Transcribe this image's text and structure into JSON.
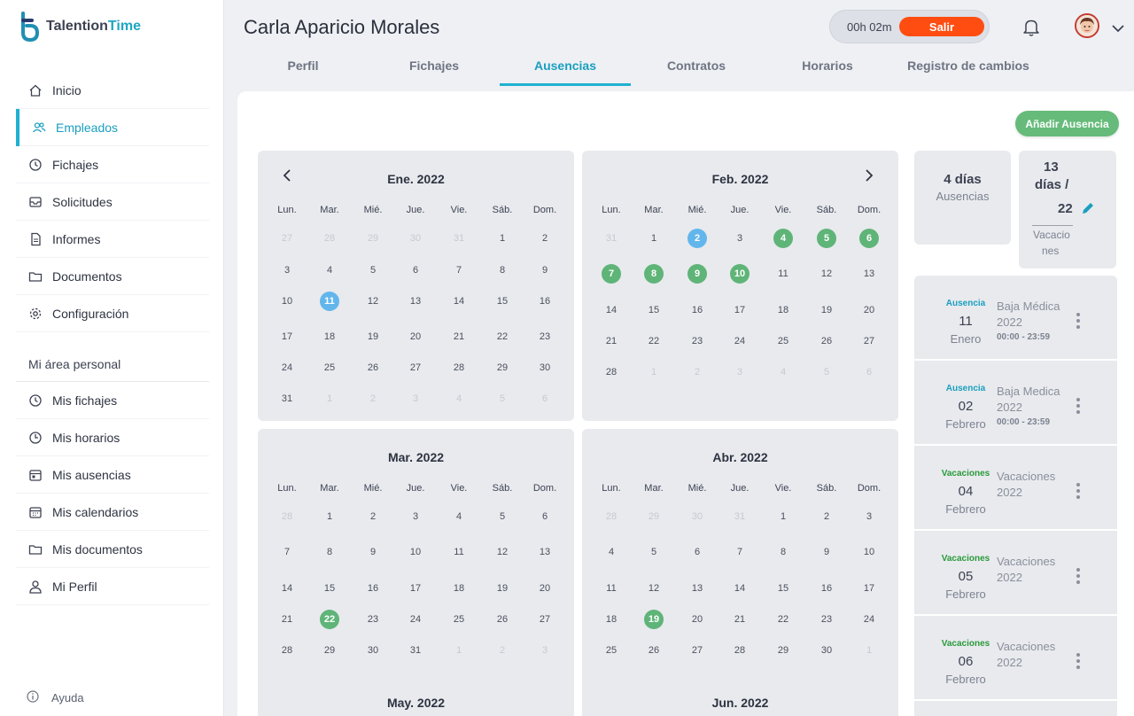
{
  "app": {
    "brand_a": "Talention",
    "brand_b": "Time"
  },
  "sidebar": {
    "items": [
      {
        "label": "Inicio",
        "icon": "home-icon",
        "active": false
      },
      {
        "label": "Empleados",
        "icon": "users-icon",
        "active": true
      },
      {
        "label": "Fichajes",
        "icon": "clock-icon",
        "active": false
      },
      {
        "label": "Solicitudes",
        "icon": "inbox-icon",
        "active": false
      },
      {
        "label": "Informes",
        "icon": "document-icon",
        "active": false
      },
      {
        "label": "Documentos",
        "icon": "folder-icon",
        "active": false
      },
      {
        "label": "Configuración",
        "icon": "gear-icon",
        "active": false
      }
    ],
    "personal_title": "Mi área personal",
    "personal_items": [
      {
        "label": "Mis fichajes",
        "icon": "clock-icon"
      },
      {
        "label": "Mis horarios",
        "icon": "time-icon"
      },
      {
        "label": "Mis ausencias",
        "icon": "calendar-icon"
      },
      {
        "label": "Mis calendarios",
        "icon": "calendar-grid-icon"
      },
      {
        "label": "Mis documentos",
        "icon": "folder-icon"
      },
      {
        "label": "Mi Perfil",
        "icon": "user-icon"
      }
    ],
    "help": "Ayuda"
  },
  "header": {
    "employee_name": "Carla Aparicio Morales",
    "timer": "00h 02m",
    "exit_label": "Salir"
  },
  "tabs": [
    {
      "label": "Perfil",
      "active": false
    },
    {
      "label": "Fichajes",
      "active": false
    },
    {
      "label": "Ausencias",
      "active": true
    },
    {
      "label": "Contratos",
      "active": false
    },
    {
      "label": "Horarios",
      "active": false
    },
    {
      "label": "Registro de cambios",
      "active": false
    }
  ],
  "add_button": "Añadir Ausencia",
  "weekdays": [
    "Lun.",
    "Mar.",
    "Mié.",
    "Jue.",
    "Vie.",
    "Sáb.",
    "Dom."
  ],
  "months": [
    {
      "title": "Ene. 2022",
      "nav": "prev",
      "weeks": [
        [
          [
            "27",
            "o"
          ],
          [
            "28",
            "o"
          ],
          [
            "29",
            "o"
          ],
          [
            "30",
            "o"
          ],
          [
            "31",
            "o"
          ],
          [
            "1",
            ""
          ],
          [
            "2",
            ""
          ]
        ],
        [
          [
            "3",
            ""
          ],
          [
            "4",
            ""
          ],
          [
            "5",
            ""
          ],
          [
            "6",
            ""
          ],
          [
            "7",
            ""
          ],
          [
            "8",
            ""
          ],
          [
            "9",
            ""
          ]
        ],
        [
          [
            "10",
            ""
          ],
          [
            "11",
            "a"
          ],
          [
            "12",
            ""
          ],
          [
            "13",
            ""
          ],
          [
            "14",
            ""
          ],
          [
            "15",
            ""
          ],
          [
            "16",
            ""
          ]
        ],
        [
          [
            "17",
            ""
          ],
          [
            "18",
            ""
          ],
          [
            "19",
            ""
          ],
          [
            "20",
            ""
          ],
          [
            "21",
            ""
          ],
          [
            "22",
            ""
          ],
          [
            "23",
            ""
          ]
        ],
        [
          [
            "24",
            ""
          ],
          [
            "25",
            ""
          ],
          [
            "26",
            ""
          ],
          [
            "27",
            ""
          ],
          [
            "28",
            ""
          ],
          [
            "29",
            ""
          ],
          [
            "30",
            ""
          ]
        ],
        [
          [
            "31",
            ""
          ],
          [
            "1",
            "o"
          ],
          [
            "2",
            "o"
          ],
          [
            "3",
            "o"
          ],
          [
            "4",
            "o"
          ],
          [
            "5",
            "o"
          ],
          [
            "6",
            "o"
          ]
        ]
      ]
    },
    {
      "title": "Feb. 2022",
      "nav": "next",
      "weeks": [
        [
          [
            "31",
            "o"
          ],
          [
            "1",
            ""
          ],
          [
            "2",
            "a"
          ],
          [
            "3",
            ""
          ],
          [
            "4",
            "v"
          ],
          [
            "5",
            "v"
          ],
          [
            "6",
            "v"
          ]
        ],
        [
          [
            "7",
            "v"
          ],
          [
            "8",
            "v"
          ],
          [
            "9",
            "v"
          ],
          [
            "10",
            "v"
          ],
          [
            "11",
            ""
          ],
          [
            "12",
            ""
          ],
          [
            "13",
            ""
          ]
        ],
        [
          [
            "14",
            ""
          ],
          [
            "15",
            ""
          ],
          [
            "16",
            ""
          ],
          [
            "17",
            ""
          ],
          [
            "18",
            ""
          ],
          [
            "19",
            ""
          ],
          [
            "20",
            ""
          ]
        ],
        [
          [
            "21",
            ""
          ],
          [
            "22",
            ""
          ],
          [
            "23",
            ""
          ],
          [
            "24",
            ""
          ],
          [
            "25",
            ""
          ],
          [
            "26",
            ""
          ],
          [
            "27",
            ""
          ]
        ],
        [
          [
            "28",
            ""
          ],
          [
            "1",
            "o"
          ],
          [
            "2",
            "o"
          ],
          [
            "3",
            "o"
          ],
          [
            "4",
            "o"
          ],
          [
            "5",
            "o"
          ],
          [
            "6",
            "o"
          ]
        ]
      ]
    },
    {
      "title": "Mar. 2022",
      "nav": "",
      "weeks": [
        [
          [
            "28",
            "o"
          ],
          [
            "1",
            ""
          ],
          [
            "2",
            ""
          ],
          [
            "3",
            ""
          ],
          [
            "4",
            ""
          ],
          [
            "5",
            ""
          ],
          [
            "6",
            ""
          ]
        ],
        [
          [
            "7",
            ""
          ],
          [
            "8",
            ""
          ],
          [
            "9",
            ""
          ],
          [
            "10",
            ""
          ],
          [
            "11",
            ""
          ],
          [
            "12",
            ""
          ],
          [
            "13",
            ""
          ]
        ],
        [
          [
            "14",
            ""
          ],
          [
            "15",
            ""
          ],
          [
            "16",
            ""
          ],
          [
            "17",
            ""
          ],
          [
            "18",
            ""
          ],
          [
            "19",
            ""
          ],
          [
            "20",
            ""
          ]
        ],
        [
          [
            "21",
            ""
          ],
          [
            "22",
            "v"
          ],
          [
            "23",
            ""
          ],
          [
            "24",
            ""
          ],
          [
            "25",
            ""
          ],
          [
            "26",
            ""
          ],
          [
            "27",
            ""
          ]
        ],
        [
          [
            "28",
            ""
          ],
          [
            "29",
            ""
          ],
          [
            "30",
            ""
          ],
          [
            "31",
            ""
          ],
          [
            "1",
            "o"
          ],
          [
            "2",
            "o"
          ],
          [
            "3",
            "o"
          ]
        ]
      ]
    },
    {
      "title": "Abr. 2022",
      "nav": "",
      "weeks": [
        [
          [
            "28",
            "o"
          ],
          [
            "29",
            "o"
          ],
          [
            "30",
            "o"
          ],
          [
            "31",
            "o"
          ],
          [
            "1",
            ""
          ],
          [
            "2",
            ""
          ],
          [
            "3",
            ""
          ]
        ],
        [
          [
            "4",
            ""
          ],
          [
            "5",
            ""
          ],
          [
            "6",
            ""
          ],
          [
            "7",
            ""
          ],
          [
            "8",
            ""
          ],
          [
            "9",
            ""
          ],
          [
            "10",
            ""
          ]
        ],
        [
          [
            "11",
            ""
          ],
          [
            "12",
            ""
          ],
          [
            "13",
            ""
          ],
          [
            "14",
            ""
          ],
          [
            "15",
            ""
          ],
          [
            "16",
            ""
          ],
          [
            "17",
            ""
          ]
        ],
        [
          [
            "18",
            ""
          ],
          [
            "19",
            "v"
          ],
          [
            "20",
            ""
          ],
          [
            "21",
            ""
          ],
          [
            "22",
            ""
          ],
          [
            "23",
            ""
          ],
          [
            "24",
            ""
          ]
        ],
        [
          [
            "25",
            ""
          ],
          [
            "26",
            ""
          ],
          [
            "27",
            ""
          ],
          [
            "28",
            ""
          ],
          [
            "29",
            ""
          ],
          [
            "30",
            ""
          ],
          [
            "1",
            "o"
          ]
        ]
      ]
    },
    {
      "title": "May. 2022",
      "nav": "",
      "weeks": []
    },
    {
      "title": "Jun. 2022",
      "nav": "",
      "weeks": []
    }
  ],
  "summary": {
    "absences_value": "4 días",
    "absences_label": "Ausencias",
    "vacation_used": "13",
    "vacation_unit": "días /",
    "vacation_total": "22",
    "vacation_label_a": "Vacacio",
    "vacation_label_b": "nes"
  },
  "absences": [
    {
      "type": "Ausencia",
      "kind": "ausencia",
      "day": "11",
      "month": "Enero",
      "title_a": "Baja Médica",
      "title_b": "2022",
      "time": "00:00 - 23:59"
    },
    {
      "type": "Ausencia",
      "kind": "ausencia",
      "day": "02",
      "month": "Febrero",
      "title_a": "Baja Medica",
      "title_b": "2022",
      "time": "00:00 - 23:59"
    },
    {
      "type": "Vacaciones",
      "kind": "vacaciones",
      "day": "04",
      "month": "Febrero",
      "title_a": "Vacaciones",
      "title_b": "2022",
      "time": ""
    },
    {
      "type": "Vacaciones",
      "kind": "vacaciones",
      "day": "05",
      "month": "Febrero",
      "title_a": "Vacaciones",
      "title_b": "2022",
      "time": ""
    },
    {
      "type": "Vacaciones",
      "kind": "vacaciones",
      "day": "06",
      "month": "Febrero",
      "title_a": "Vacaciones",
      "title_b": "2022",
      "time": ""
    }
  ],
  "colors": {
    "accent": "#1fb1d1",
    "ausencia": "#1a9fbf",
    "vacaciones": "#2a9a3a",
    "salir": "#ff4d12",
    "add": "#66bb7a"
  }
}
